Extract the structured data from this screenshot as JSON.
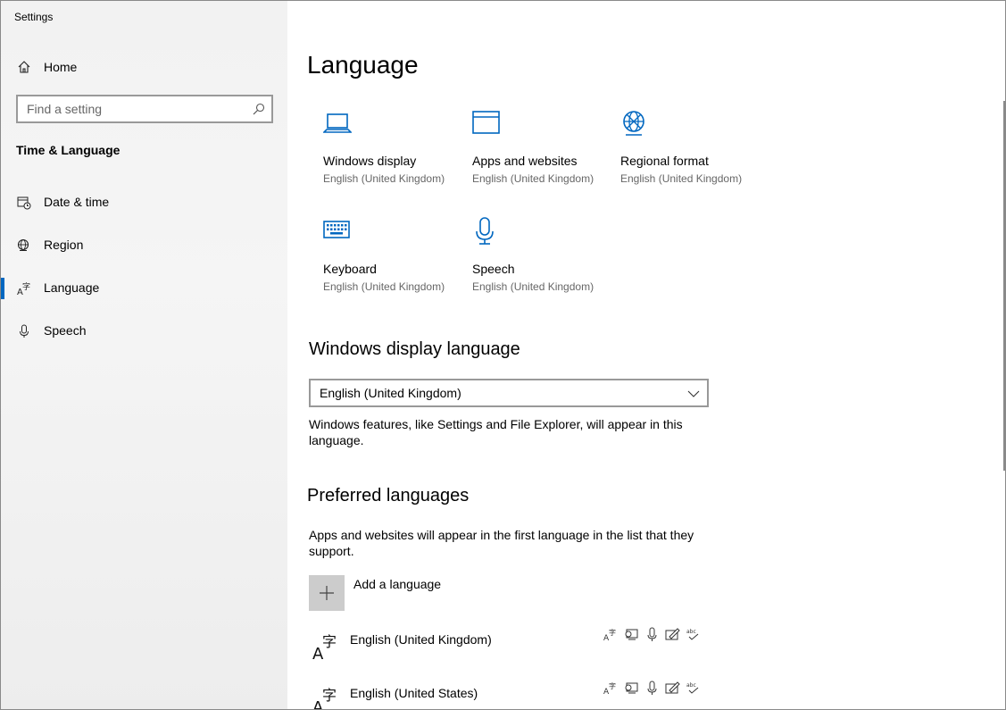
{
  "window": {
    "title": "Settings"
  },
  "sidebar": {
    "home_label": "Home",
    "search_placeholder": "Find a setting",
    "section_title": "Time & Language",
    "items": [
      {
        "label": "Date & time",
        "icon": "calendar-clock-icon"
      },
      {
        "label": "Region",
        "icon": "globe-icon"
      },
      {
        "label": "Language",
        "icon": "language-icon",
        "active": true
      },
      {
        "label": "Speech",
        "icon": "microphone-icon"
      }
    ]
  },
  "main": {
    "title": "Language",
    "tiles": [
      {
        "title": "Windows display",
        "subtitle": "English (United Kingdom)",
        "icon": "laptop-icon"
      },
      {
        "title": "Apps and websites",
        "subtitle": "English (United Kingdom)",
        "icon": "window-icon"
      },
      {
        "title": "Regional format",
        "subtitle": "English (United Kingdom)",
        "icon": "globe-icon"
      },
      {
        "title": "Keyboard",
        "subtitle": "English (United Kingdom)",
        "icon": "keyboard-icon"
      },
      {
        "title": "Speech",
        "subtitle": "English (United Kingdom)",
        "icon": "microphone-icon"
      }
    ],
    "display_language": {
      "heading": "Windows display language",
      "selected": "English (United Kingdom)",
      "description": "Windows features, like Settings and File Explorer, will appear in this language."
    },
    "preferred": {
      "heading": "Preferred languages",
      "description": "Apps and websites will appear in the first language in the list that they support.",
      "add_label": "Add a language",
      "languages": [
        {
          "label": "English (United Kingdom)"
        },
        {
          "label": "English (United States)"
        }
      ]
    }
  },
  "colors": {
    "accent": "#0067c0",
    "sidebar_bg": "#f2f2f2",
    "secondary_text": "#666666"
  }
}
